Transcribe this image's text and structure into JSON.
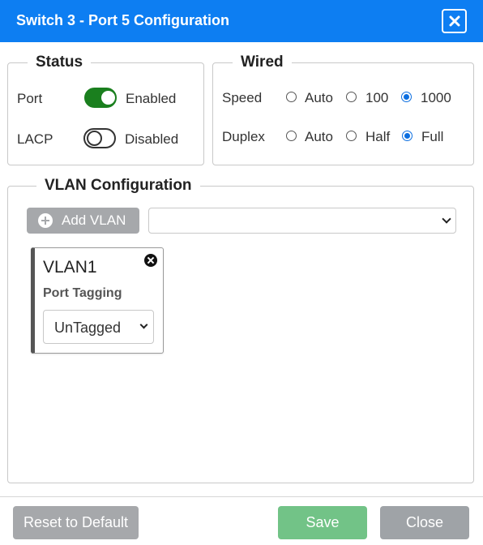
{
  "dialog": {
    "title": "Switch 3 - Port 5 Configuration"
  },
  "status": {
    "legend": "Status",
    "port": {
      "label": "Port",
      "state": "Enabled",
      "on": true
    },
    "lacp": {
      "label": "LACP",
      "state": "Disabled",
      "on": false
    }
  },
  "wired": {
    "legend": "Wired",
    "speed": {
      "label": "Speed",
      "options": [
        "Auto",
        "100",
        "1000"
      ],
      "selected": "1000"
    },
    "duplex": {
      "label": "Duplex",
      "options": [
        "Auto",
        "Half",
        "Full"
      ],
      "selected": "Full"
    }
  },
  "vlan_config": {
    "legend": "VLAN Configuration",
    "add_button": "Add VLAN",
    "select_value": "",
    "vlans": [
      {
        "name": "VLAN1",
        "tagging_label": "Port Tagging",
        "tagging_value": "UnTagged"
      }
    ]
  },
  "footer": {
    "reset_label": "Reset to Default",
    "save_label": "Save",
    "close_label": "Close"
  },
  "colors": {
    "header": "#0d7ef2",
    "toggle_on": "#1a7f1e",
    "radio_checked": "#0b6ee0",
    "save_button": "#72c387",
    "close_button": "#9fa3a7",
    "reset_button": "#a6a8ab"
  }
}
